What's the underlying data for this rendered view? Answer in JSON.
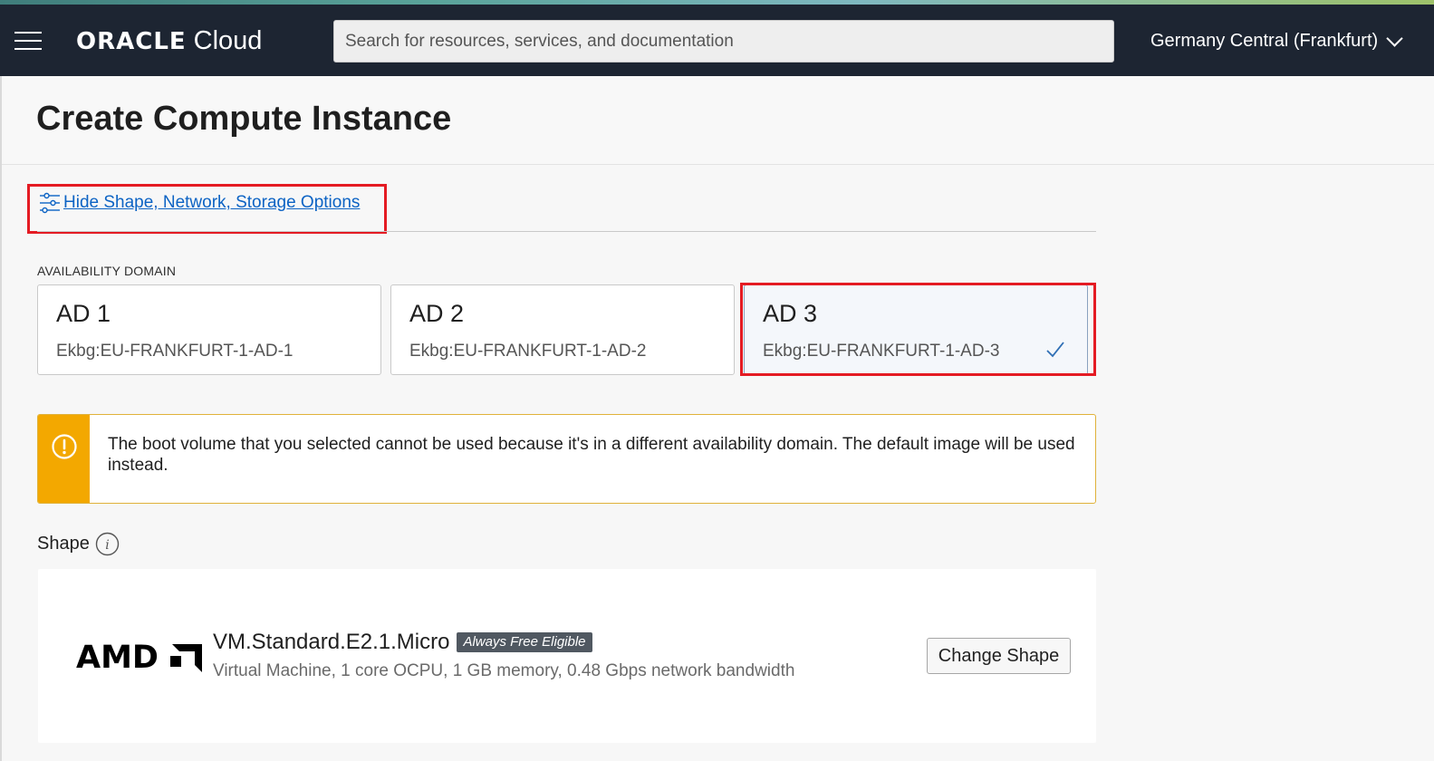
{
  "header": {
    "brand": "ORACLE",
    "product": "Cloud",
    "search_placeholder": "Search for resources, services, and documentation",
    "region": "Germany Central (Frankfurt)"
  },
  "page": {
    "title": "Create Compute Instance"
  },
  "advanced_options": {
    "link_label": "Hide Shape, Network, Storage Options"
  },
  "availability_domain": {
    "label": "AVAILABILITY DOMAIN",
    "selected": "AD 3",
    "options": [
      {
        "name": "AD 1",
        "id": "Ekbg:EU-FRANKFURT-1-AD-1"
      },
      {
        "name": "AD 2",
        "id": "Ekbg:EU-FRANKFURT-1-AD-2"
      },
      {
        "name": "AD 3",
        "id": "Ekbg:EU-FRANKFURT-1-AD-3"
      }
    ]
  },
  "warning": {
    "message": "The boot volume that you selected cannot be used because it's in a different availability domain. The default image will be used instead.",
    "icon": "exclamation-circle-icon",
    "color": "#f3a800"
  },
  "shape": {
    "section_label": "Shape",
    "vendor": "AMD",
    "name": "VM.Standard.E2.1.Micro",
    "badge": "Always Free Eligible",
    "description": "Virtual Machine, 1 core OCPU, 1 GB memory, 0.48 Gbps network bandwidth",
    "change_button": "Change Shape"
  },
  "colors": {
    "header_bg": "#1d2532",
    "link": "#0c63c4",
    "highlight": "#e41b23"
  }
}
